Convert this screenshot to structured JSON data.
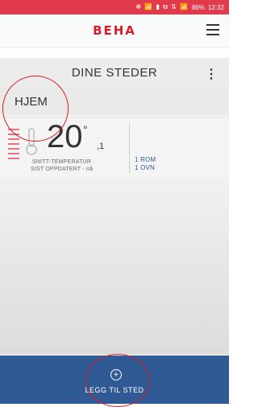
{
  "status_bar": {
    "icons": "✻ 📶 ▮ ⧉ ⇅ 📶",
    "battery": "86%",
    "time": "12:32"
  },
  "app": {
    "logo": "BEHA"
  },
  "section": {
    "title": "DINE STEDER"
  },
  "place": {
    "name": "HJEM",
    "temperature_whole": "20",
    "degree_symbol": "°",
    "temperature_decimal": ",1",
    "temp_label": "SNITT-TEMPERATUR",
    "updated_label": "SIST OPPDATERT - nå",
    "rooms": "1 ROM",
    "ovens": "1 OVN"
  },
  "bottom": {
    "add_label": "LEGG TIL STED",
    "add_icon": "+"
  },
  "colors": {
    "status_red": "#e23a4d",
    "brand_red": "#d61f2b",
    "bottom_blue": "#2f5a93"
  }
}
